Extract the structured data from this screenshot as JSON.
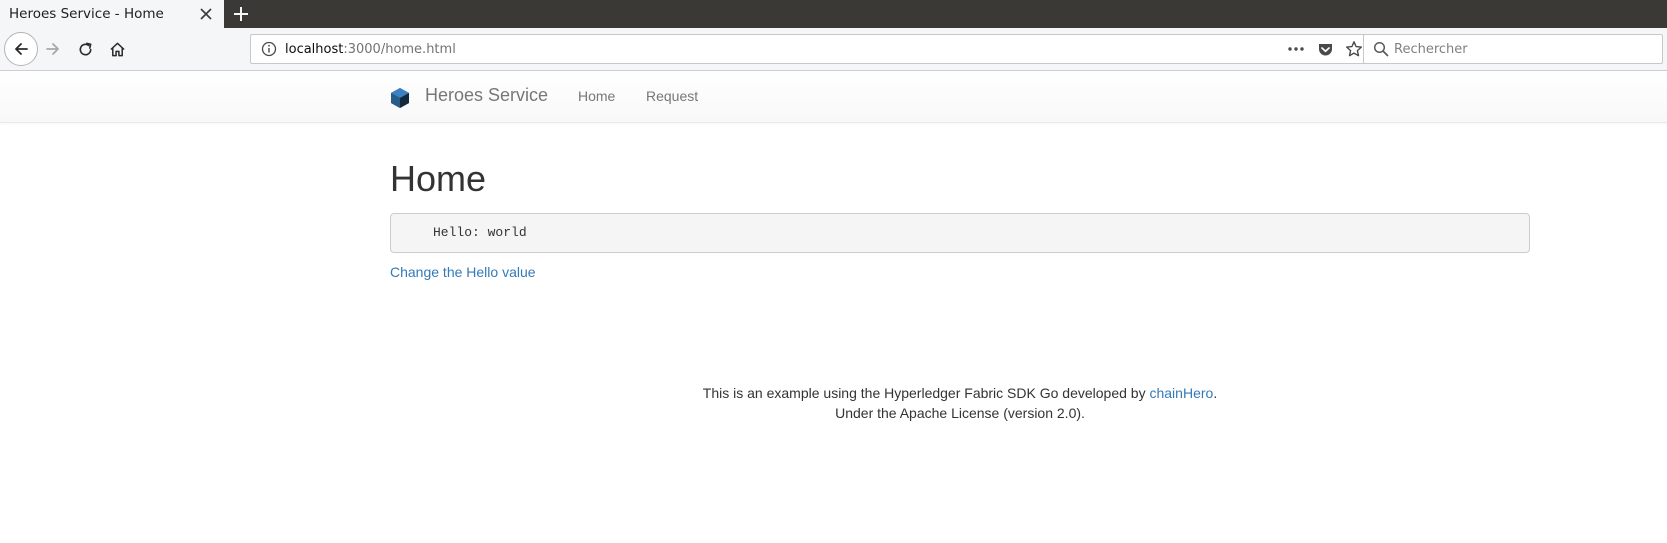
{
  "browser": {
    "tab_title": "Heroes Service - Home",
    "url_host": "localhost",
    "url_rest": ":3000/home.html",
    "search_placeholder": "Rechercher"
  },
  "site": {
    "brand": "Heroes Service",
    "nav": {
      "home": "Home",
      "request": "Request"
    }
  },
  "main": {
    "heading": "Home",
    "hello_output": "Hello: world",
    "change_link": "Change the Hello value"
  },
  "footer": {
    "line1_prefix": "This is an example using the Hyperledger Fabric SDK Go developed by ",
    "line1_link": "chainHero",
    "line1_suffix": ".",
    "line2": "Under the Apache License (version 2.0)."
  },
  "colors": {
    "link": "#337ab7",
    "tabbar": "#3b3935",
    "logo_dark": "#1d3f5e",
    "logo_light": "#3b83c0"
  },
  "icons": [
    "close-icon",
    "plus-icon",
    "back-arrow-icon",
    "forward-arrow-icon",
    "reload-icon",
    "home-icon",
    "info-icon",
    "more-icon",
    "pocket-icon",
    "star-icon",
    "search-icon",
    "cube-logo-icon"
  ]
}
